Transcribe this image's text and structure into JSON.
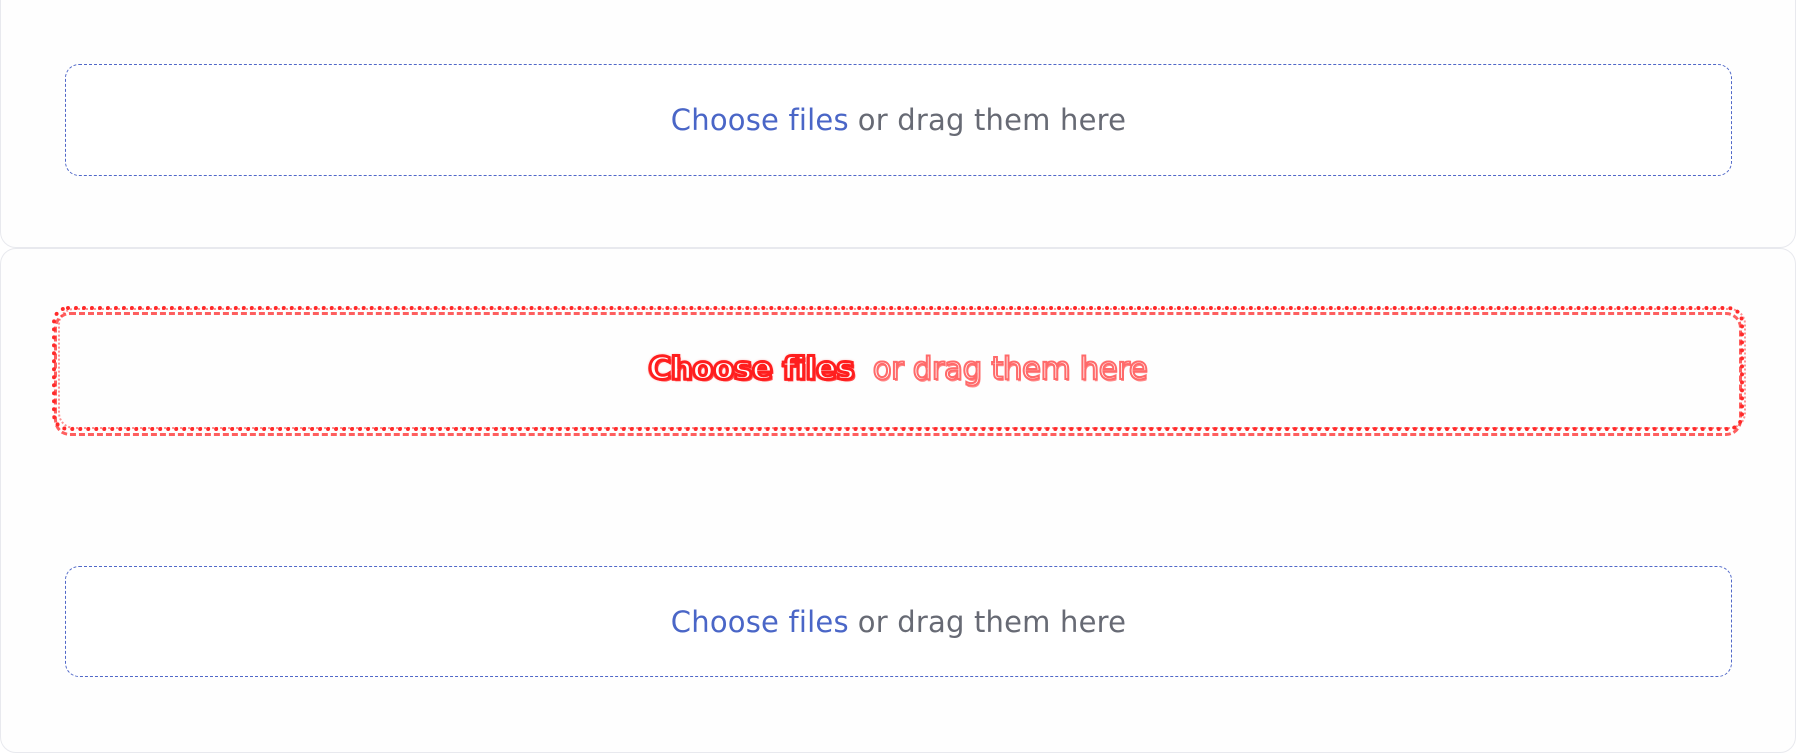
{
  "dropzones": [
    {
      "link_label": "Choose files",
      "hint": "or drag them here",
      "state": "default"
    },
    {
      "link_label": "Choose files",
      "hint": "or drag them here",
      "state": "error"
    },
    {
      "link_label": "Choose files",
      "hint": "or drag them here",
      "state": "default"
    }
  ],
  "colors": {
    "accent": "#4a66c7",
    "error": "#ff2a2a",
    "hint_text": "#676a74",
    "border_default": "#5068c8",
    "background": "#ffffff"
  }
}
